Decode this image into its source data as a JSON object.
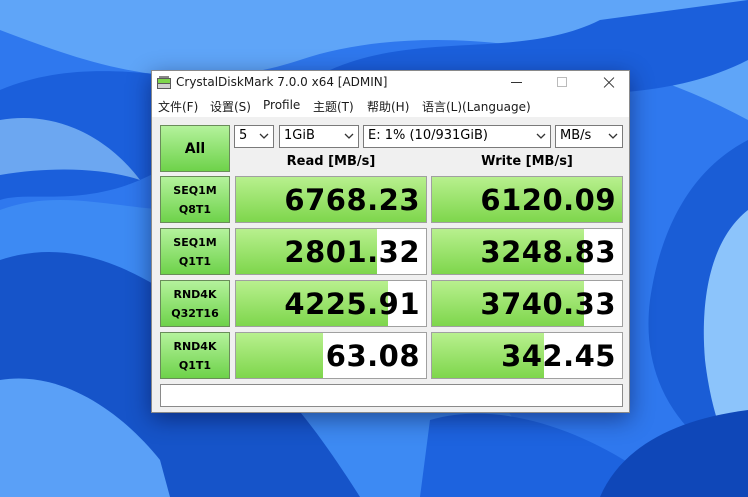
{
  "window": {
    "title": "CrystalDiskMark 7.0.0 x64 [ADMIN]"
  },
  "menu": [
    "文件(F)",
    "设置(S)",
    "Profile",
    "主题(T)",
    "帮助(H)",
    "语言(L)(Language)"
  ],
  "controls": {
    "all_label": "All",
    "count_value": "5",
    "size_value": "1GiB",
    "drive_value": "E: 1% (10/931GiB)",
    "unit_value": "MB/s"
  },
  "headers": {
    "read": "Read [MB/s]",
    "write": "Write [MB/s]"
  },
  "tests": [
    {
      "line1": "SEQ1M",
      "line2": "Q8T1",
      "read": "6768.23",
      "write": "6120.09"
    },
    {
      "line1": "SEQ1M",
      "line2": "Q1T1",
      "read": "2801.32",
      "write": "3248.83"
    },
    {
      "line1": "RND4K",
      "line2": "Q32T16",
      "read": "4225.91",
      "write": "3740.33"
    },
    {
      "line1": "RND4K",
      "line2": "Q1T1",
      "read": "63.08",
      "write": "342.45"
    }
  ],
  "bar_fill_fraction": [
    {
      "read": 1.0,
      "write": 1.0
    },
    {
      "read": 0.74,
      "write": 0.8
    },
    {
      "read": 0.8,
      "write": 0.8
    },
    {
      "read": 0.46,
      "write": 0.59
    }
  ],
  "colors": {
    "accent_green": "#7ed64c",
    "desktop_blue": "#2a6ee8"
  }
}
